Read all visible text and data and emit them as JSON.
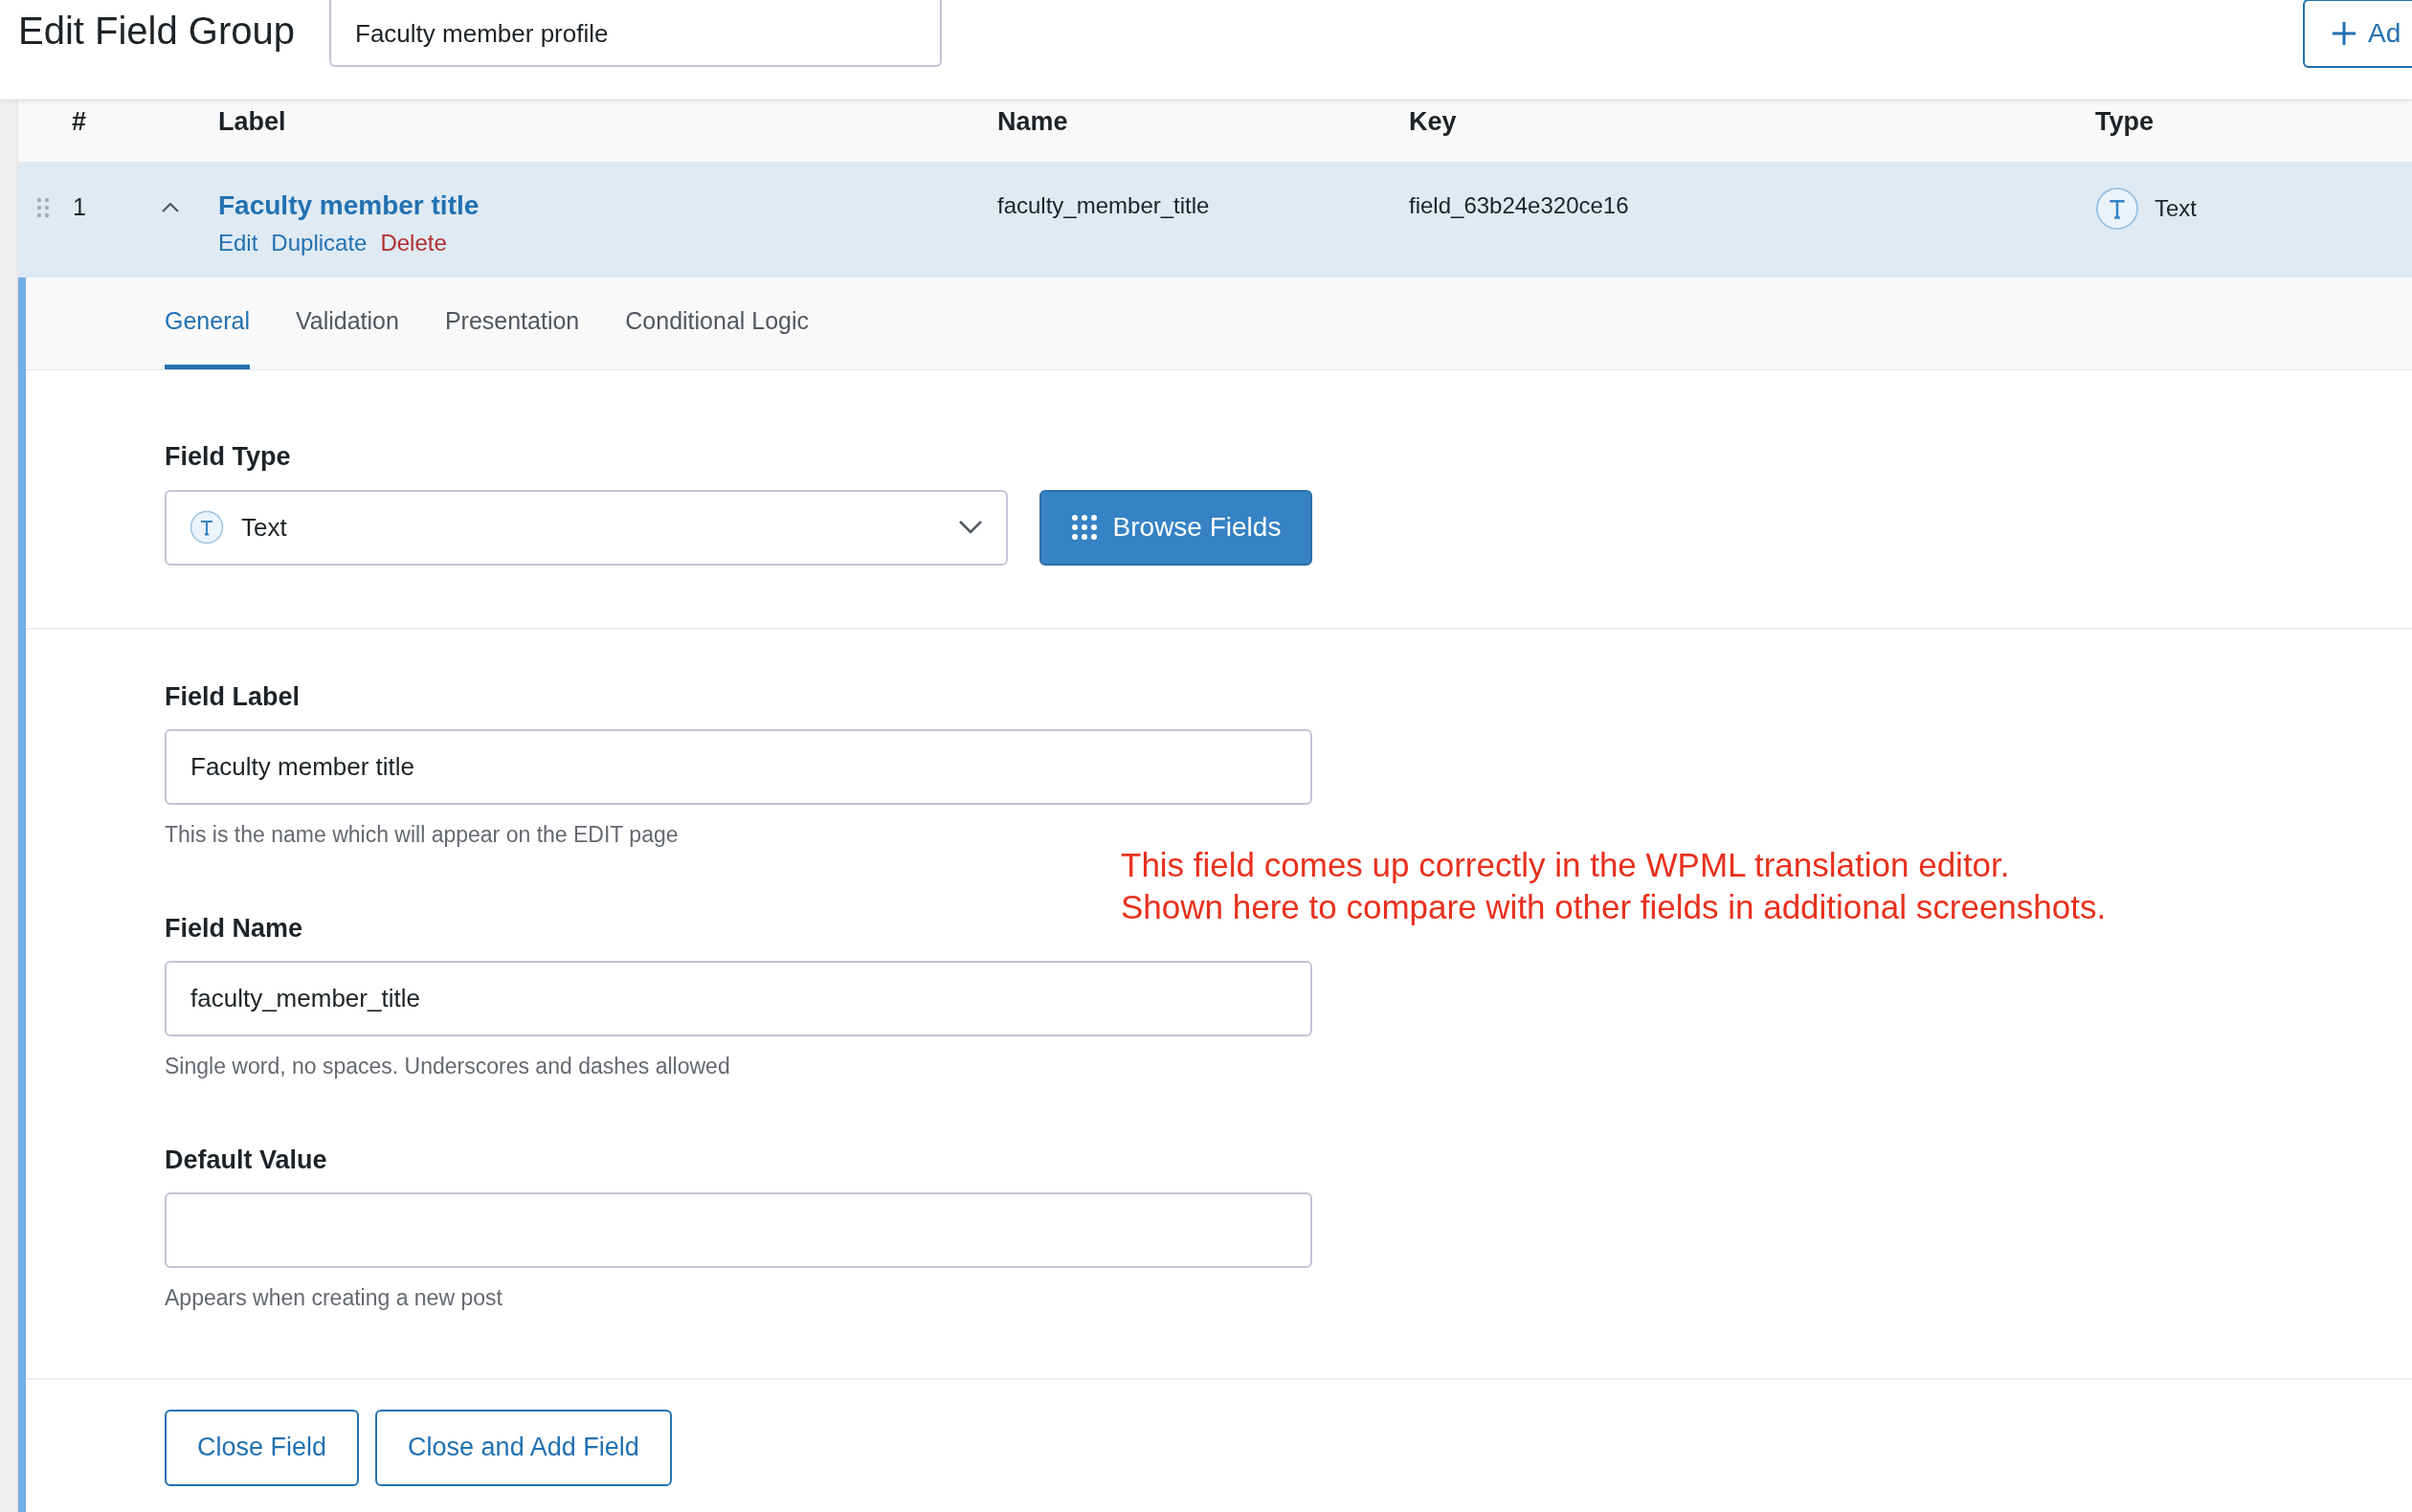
{
  "header": {
    "title": "Edit Field Group",
    "group_title": "Faculty member profile",
    "add_button": "Ad"
  },
  "table": {
    "columns": [
      "#",
      "Label",
      "Name",
      "Key",
      "Type"
    ],
    "rows": [
      {
        "number": "1",
        "expanded": true,
        "label": "Faculty member title",
        "actions": [
          {
            "label": "Edit",
            "kind": "normal"
          },
          {
            "label": "Duplicate",
            "kind": "normal"
          },
          {
            "label": "Delete",
            "kind": "danger"
          }
        ],
        "name": "faculty_member_title",
        "key": "field_63b24e320ce16",
        "type": "Text"
      }
    ]
  },
  "tabs": [
    {
      "label": "General",
      "selected": true
    },
    {
      "label": "Validation",
      "selected": false
    },
    {
      "label": "Presentation",
      "selected": false
    },
    {
      "label": "Conditional Logic",
      "selected": false
    }
  ],
  "field_type": {
    "label": "Field Type",
    "value": "Text",
    "browse_button": "Browse Fields"
  },
  "fields": [
    {
      "label": "Field Label",
      "value": "Faculty member title",
      "hint": "This is the name which will appear on the EDIT page"
    },
    {
      "label": "Field Name",
      "value": "faculty_member_title",
      "hint": "Single word, no spaces. Underscores and dashes allowed"
    },
    {
      "label": "Default Value",
      "hint": "Appears when creating a new post"
    }
  ],
  "annotation": [
    "This field comes up correctly in the WPML translation editor.",
    "Shown here to compare with other fields in additional screenshots."
  ],
  "footer_buttons": [
    "Close Field",
    "Close and Add Field"
  ]
}
